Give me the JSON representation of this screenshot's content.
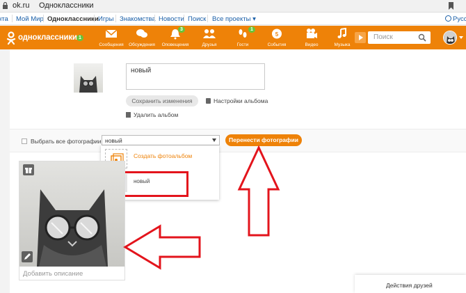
{
  "browser": {
    "url": "ok.ru",
    "title": "Одноклассники"
  },
  "portal_nav": {
    "items": [
      "нта",
      "Мой Мир",
      "Одноклассники",
      "Игры",
      "Знакомства",
      "Новости",
      "Поиск",
      "Все проекты ▾"
    ],
    "language": "Русс"
  },
  "toolbar": {
    "logo_text": "одноклассники",
    "logo_badge": "1",
    "items": [
      {
        "label": "Сообщения",
        "icon": "envelope-icon",
        "badge": ""
      },
      {
        "label": "Обсуждения",
        "icon": "chat-bubbles-icon",
        "badge": ""
      },
      {
        "label": "Оповещения",
        "icon": "bell-icon",
        "badge": "3"
      },
      {
        "label": "Друзья",
        "icon": "friends-icon",
        "badge": ""
      },
      {
        "label": "Гости",
        "icon": "footprints-icon",
        "badge": "1"
      },
      {
        "label": "События",
        "icon": "events-icon",
        "badge": ""
      },
      {
        "label": "Видео",
        "icon": "video-camera-icon",
        "badge": ""
      },
      {
        "label": "Музыка",
        "icon": "music-note-icon",
        "badge": ""
      }
    ],
    "search_placeholder": "Поиск"
  },
  "album": {
    "name_value": "новый",
    "save_label": "Сохранить изменения",
    "settings_label": "Настройки альбома",
    "delete_label": "Удалить альбом"
  },
  "controls": {
    "select_all_label": "Выбрать все фотографии",
    "album_select_value": "новый",
    "move_button_label": "Перенести фотографии"
  },
  "dropdown": {
    "create_label": "Создать фотоальбом",
    "album_item_label": "новый"
  },
  "photo": {
    "description_placeholder": "Добавить описание"
  },
  "friends_panel": {
    "label": "Действия друзей"
  },
  "colors": {
    "accent": "#ee8208",
    "badge_green": "#68c43a",
    "annotation_red": "#e3141c"
  }
}
